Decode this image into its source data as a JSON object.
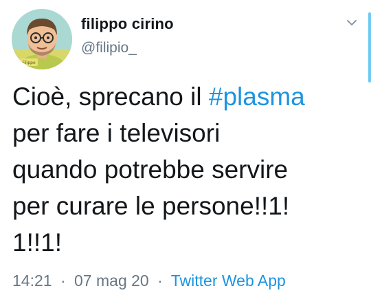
{
  "author": {
    "display_name": "filippo cirino",
    "handle": "@filipio_",
    "avatar_caption": "Filippo"
  },
  "tweet": {
    "line1_before": "Cioè, sprecano il ",
    "hashtag": "#plasma",
    "line2": "per fare i televisori",
    "line3": "quando potrebbe servire",
    "line4": "per curare le persone!!1!",
    "line5": "1!!1!"
  },
  "meta": {
    "time": "14:21",
    "separator": "·",
    "date": "07 mag 20",
    "source": "Twitter Web App"
  },
  "icons": {
    "caret": "chevron-down-icon"
  },
  "colors": {
    "link": "#1b95e0",
    "secondary_text": "#657786",
    "primary_text": "#14171a"
  }
}
